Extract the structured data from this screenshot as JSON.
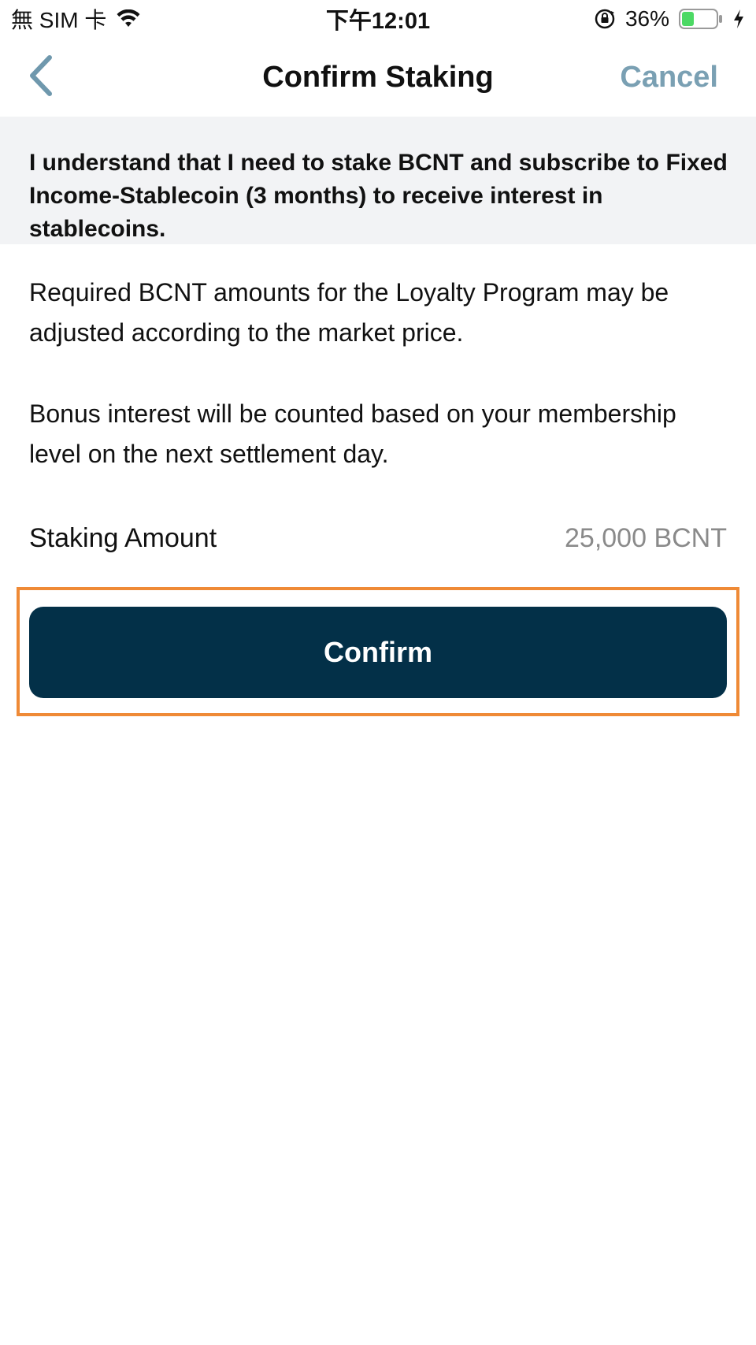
{
  "status_bar": {
    "carrier": "無 SIM 卡",
    "time": "下午12:01",
    "battery_percent": "36%",
    "battery_level": 0.36,
    "icons": [
      "wifi-icon",
      "lock-rotation-icon",
      "battery-icon",
      "charging-icon"
    ]
  },
  "nav": {
    "title": "Confirm Staking",
    "cancel_label": "Cancel",
    "back_icon": "chevron-left-icon"
  },
  "notice": {
    "text": "I understand that I need to stake BCNT and subscribe to Fixed Income-Stablecoin (3 months) to receive interest in stablecoins."
  },
  "content": {
    "paragraph_1": "Required BCNT amounts for the Loyalty Program may be adjusted according to the market price.",
    "paragraph_2": "Bonus interest will be counted based on your membership level on the next settlement day."
  },
  "staking": {
    "label": "Staking Amount",
    "value": "25,000 BCNT"
  },
  "confirm": {
    "label": "Confirm"
  },
  "colors": {
    "accent": "#7aa0b3",
    "button_bg": "#033048",
    "highlight": "#ef8a36",
    "banner_bg": "#f2f3f5",
    "battery_green": "#4cd964"
  }
}
